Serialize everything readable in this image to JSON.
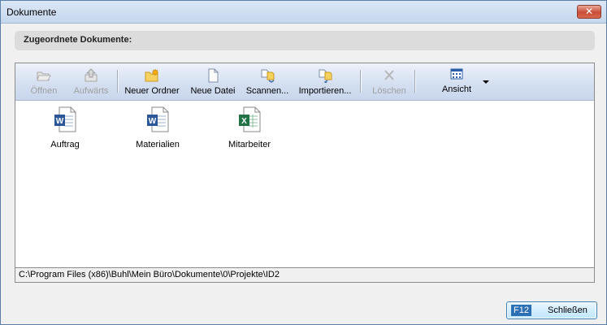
{
  "window": {
    "title": "Dokumente",
    "close_glyph": "✕"
  },
  "header": {
    "label": "Zugeordnete Dokumente:"
  },
  "toolbar": {
    "open": "Öffnen",
    "up": "Aufwärts",
    "new_folder": "Neuer Ordner",
    "new_file": "Neue Datei",
    "scan": "Scannen...",
    "import": "Importieren...",
    "delete": "Löschen",
    "view": "Ansicht"
  },
  "files": [
    {
      "name": "Auftrag",
      "icon": "word-document-icon"
    },
    {
      "name": "Materialien",
      "icon": "word-document-icon"
    },
    {
      "name": "Mitarbeiter",
      "icon": "excel-document-icon"
    }
  ],
  "path": "C:\\Program Files (x86)\\Buhl\\Mein Büro\\Dokumente\\0\\Projekte\\ID2",
  "footer": {
    "close_key": "F12",
    "close_label": "Schließen"
  },
  "colors": {
    "word": "#2b579a",
    "excel": "#217346",
    "accent": "#2c6fb5"
  }
}
